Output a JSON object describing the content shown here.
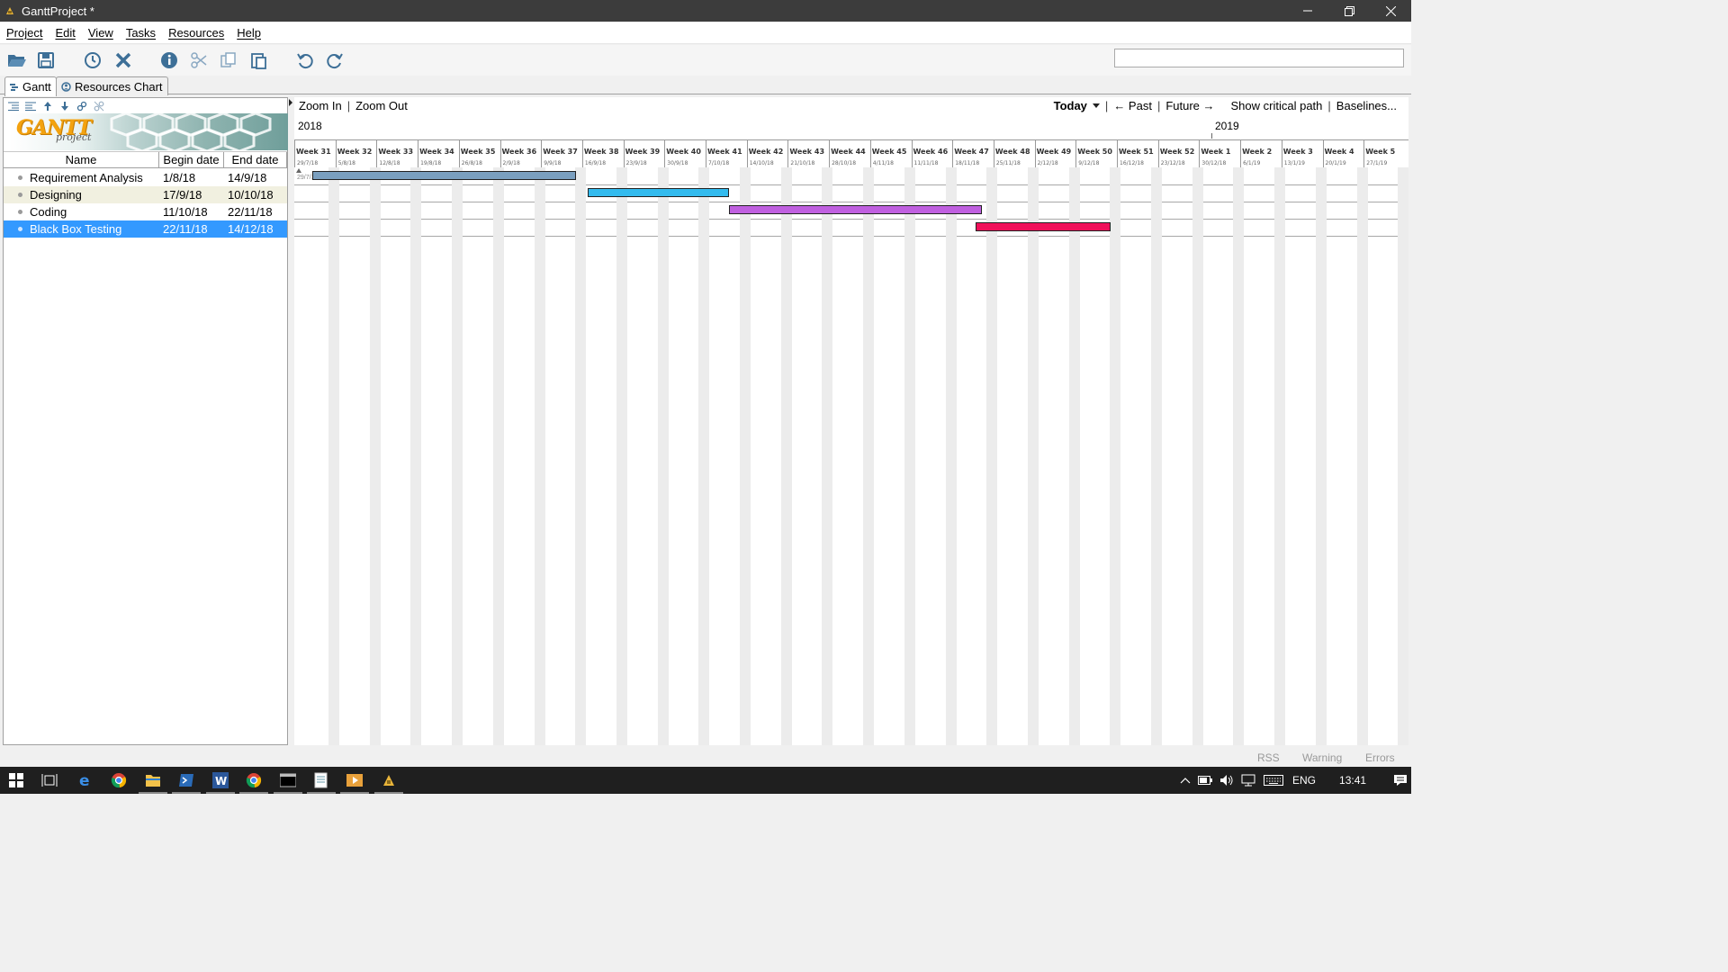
{
  "window": {
    "title": "GanttProject *"
  },
  "menu": [
    "Project",
    "Edit",
    "View",
    "Tasks",
    "Resources",
    "Help"
  ],
  "toolbar": {
    "icons": [
      "open-folder-icon",
      "save-icon",
      "history-icon",
      "delete-icon",
      "properties-icon",
      "cut-icon",
      "copy-icon",
      "paste-icon",
      "undo-icon",
      "redo-icon"
    ],
    "search_value": ""
  },
  "tabs": [
    {
      "label": "Gantt",
      "active": true
    },
    {
      "label": "Resources Chart",
      "active": false
    }
  ],
  "logo": {
    "text": "GANTT",
    "sub": "project"
  },
  "task_table": {
    "columns": [
      "Name",
      "Begin date",
      "End date"
    ],
    "rows": [
      {
        "name": "Requirement Analysis",
        "begin": "1/8/18",
        "end": "14/9/18",
        "selected": false
      },
      {
        "name": "Designing",
        "begin": "17/9/18",
        "end": "10/10/18",
        "selected": false
      },
      {
        "name": "Coding",
        "begin": "11/10/18",
        "end": "22/11/18",
        "selected": false
      },
      {
        "name": "Black Box Testing",
        "begin": "22/11/18",
        "end": "14/12/18",
        "selected": true
      }
    ]
  },
  "chart_toolbar": {
    "zoom_in": "Zoom In",
    "zoom_out": "Zoom Out",
    "sep": "|",
    "today": "Today",
    "past": "← Past",
    "future": "Future →",
    "critical_path": "Show critical path",
    "baselines": "Baselines..."
  },
  "timeline": {
    "years": [
      "2018",
      "2019"
    ],
    "weeks": [
      {
        "week": "Week 31",
        "date": "29/7/18"
      },
      {
        "week": "Week 32",
        "date": "5/8/18"
      },
      {
        "week": "Week 33",
        "date": "12/8/18"
      },
      {
        "week": "Week 34",
        "date": "19/8/18"
      },
      {
        "week": "Week 35",
        "date": "26/8/18"
      },
      {
        "week": "Week 36",
        "date": "2/9/18"
      },
      {
        "week": "Week 37",
        "date": "9/9/18"
      },
      {
        "week": "Week 38",
        "date": "16/9/18"
      },
      {
        "week": "Week 39",
        "date": "23/9/18"
      },
      {
        "week": "Week 40",
        "date": "30/9/18"
      },
      {
        "week": "Week 41",
        "date": "7/10/18"
      },
      {
        "week": "Week 42",
        "date": "14/10/18"
      },
      {
        "week": "Week 43",
        "date": "21/10/18"
      },
      {
        "week": "Week 44",
        "date": "28/10/18"
      },
      {
        "week": "Week 45",
        "date": "4/11/18"
      },
      {
        "week": "Week 46",
        "date": "11/11/18"
      },
      {
        "week": "Week 47",
        "date": "18/11/18"
      },
      {
        "week": "Week 48",
        "date": "25/11/18"
      },
      {
        "week": "Week 49",
        "date": "2/12/18"
      },
      {
        "week": "Week 50",
        "date": "9/12/18"
      },
      {
        "week": "Week 51",
        "date": "16/12/18"
      },
      {
        "week": "Week 52",
        "date": "23/12/18"
      },
      {
        "week": "Week 1",
        "date": "30/12/18"
      },
      {
        "week": "Week 2",
        "date": "6/1/19"
      },
      {
        "week": "Week 3",
        "date": "13/1/19"
      },
      {
        "week": "Week 4",
        "date": "20/1/19"
      },
      {
        "week": "Week 5",
        "date": "27/1/19"
      }
    ],
    "today_marker_label": "29/7/18"
  },
  "gantt_bars": [
    {
      "task": "Requirement Analysis",
      "start": "1/8/18",
      "end": "14/9/18",
      "color": "#7a9fbf"
    },
    {
      "task": "Designing",
      "start": "17/9/18",
      "end": "10/10/18",
      "color": "#33bbee"
    },
    {
      "task": "Coding",
      "start": "11/10/18",
      "end": "22/11/18",
      "color": "#c060e0"
    },
    {
      "task": "Black Box Testing",
      "start": "22/11/18",
      "end": "14/12/18",
      "color": "#f0105a"
    }
  ],
  "statusbar": {
    "rss": "RSS",
    "warning": "Warning",
    "errors": "Errors"
  },
  "taskbar": {
    "apps": [
      "start-icon",
      "task-view-icon",
      "edge-icon",
      "chrome-icon",
      "file-explorer-icon",
      "powershell-icon",
      "word-icon",
      "chrome-icon",
      "terminal-icon",
      "notepad-icon",
      "media-player-icon",
      "ganttproject-icon"
    ],
    "lang": "ENG",
    "time": "13:41"
  }
}
